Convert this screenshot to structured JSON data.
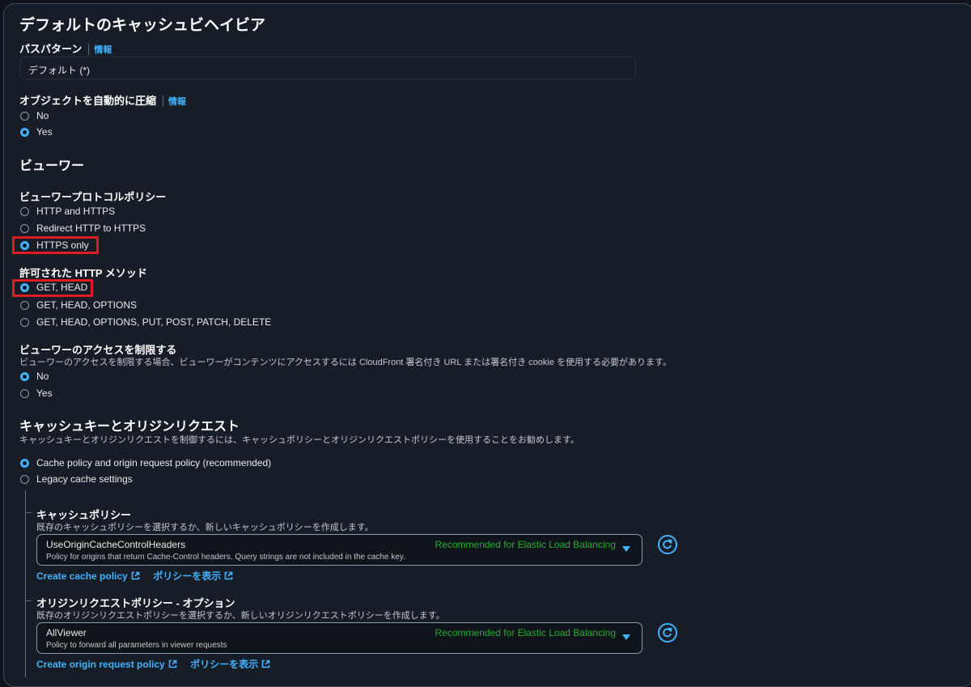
{
  "section_title": "デフォルトのキャッシュビヘイビア",
  "path_pattern": {
    "label": "パスパターン",
    "info": "情報",
    "value": "デフォルト (*)"
  },
  "compress": {
    "label": "オブジェクトを自動的に圧縮",
    "info": "情報",
    "options": [
      "No",
      "Yes"
    ],
    "selected": "Yes"
  },
  "viewer": {
    "title": "ビューワー",
    "protocol": {
      "label": "ビューワープロトコルポリシー",
      "options": [
        "HTTP and HTTPS",
        "Redirect HTTP to HTTPS",
        "HTTPS only"
      ],
      "selected": "HTTPS only"
    },
    "methods": {
      "label": "許可された HTTP メソッド",
      "options": [
        "GET, HEAD",
        "GET, HEAD, OPTIONS",
        "GET, HEAD, OPTIONS, PUT, POST, PATCH, DELETE"
      ],
      "selected": "GET, HEAD"
    },
    "restrict": {
      "label": "ビューワーのアクセスを制限する",
      "description": "ビューワーのアクセスを制限する場合、ビューワーがコンテンツにアクセスするには CloudFront 署名付き URL または署名付き cookie を使用する必要があります。",
      "options": [
        "No",
        "Yes"
      ],
      "selected": "No"
    }
  },
  "cache_key": {
    "title": "キャッシュキーとオリジンリクエスト",
    "description": "キャッシュキーとオリジンリクエストを制御するには、キャッシュポリシーとオリジンリクエストポリシーを使用することをお勧めします。",
    "options": [
      "Cache policy and origin request policy (recommended)",
      "Legacy cache settings"
    ],
    "selected": "Cache policy and origin request policy (recommended)",
    "cache_policy": {
      "label": "キャッシュポリシー",
      "description": "既存のキャッシュポリシーを選択するか、新しいキャッシュポリシーを作成します。",
      "selected_name": "UseOriginCacheControlHeaders",
      "selected_desc": "Policy for origins that return Cache-Control headers. Query strings are not included in the cache key.",
      "tag": "Recommended for Elastic Load Balancing",
      "create_link": "Create cache policy",
      "view_link": "ポリシーを表示"
    },
    "origin_request_policy": {
      "label": "オリジンリクエストポリシー - オプション",
      "description": "既存のオリジンリクエストポリシーを選択するか、新しいオリジンリクエストポリシーを作成します。",
      "selected_name": "AllViewer",
      "selected_desc": "Policy to forward all parameters in viewer requests",
      "tag": "Recommended for Elastic Load Balancing",
      "create_link": "Create origin request policy",
      "view_link": "ポリシーを表示"
    }
  },
  "colors": {
    "accent": "#42b4ff",
    "highlight": "#e01b24",
    "recommended": "#29ad32",
    "background": "#161d26"
  }
}
